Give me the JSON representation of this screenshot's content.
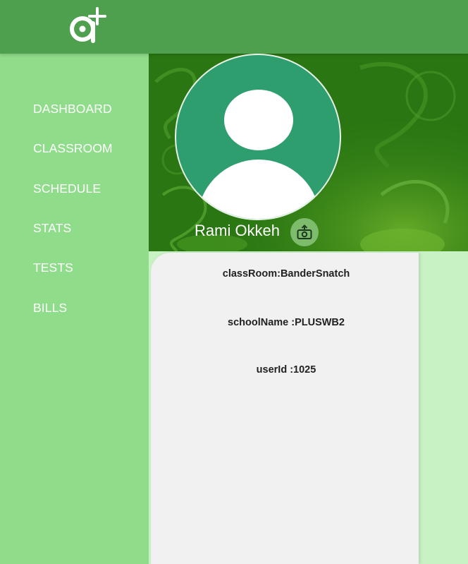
{
  "header": {
    "logo_icon": "a-plus-logo-icon"
  },
  "sidebar": {
    "items": [
      {
        "label": "DASHBOARD"
      },
      {
        "label": "CLASSROOM"
      },
      {
        "label": "SCHEDULE"
      },
      {
        "label": "STATS"
      },
      {
        "label": "TESTS"
      },
      {
        "label": "BILLS"
      }
    ]
  },
  "profile": {
    "name": "Rami Okkeh",
    "avatar_icon": "user-avatar-icon",
    "upload_icon": "upload-photo-icon"
  },
  "info": {
    "classroom": "classRoom:BanderSnatch",
    "school_name": "schoolName :PLUSWB2",
    "user_id": "userId :1025"
  },
  "colors": {
    "header": "#4ea04e",
    "sidebar": "#8fdc8a",
    "banner": "#2e7d15",
    "avatar_bg": "#2e9e6e",
    "card": "#f1f1f1",
    "page_bg": "#c9f2c4"
  }
}
